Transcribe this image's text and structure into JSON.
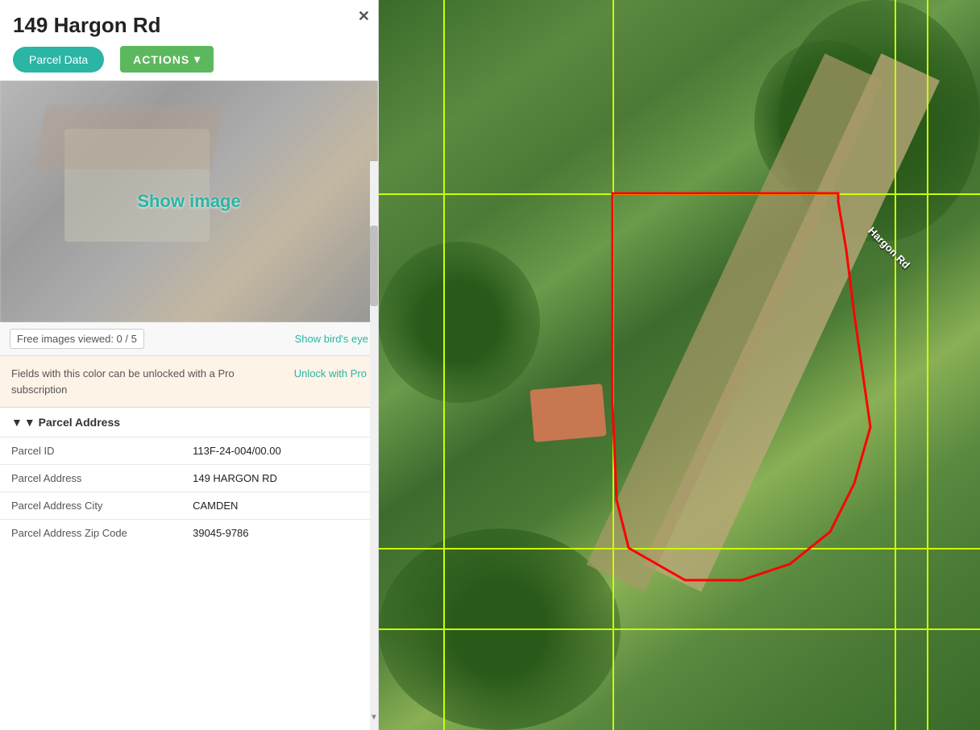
{
  "panel": {
    "title": "149 Hargon Rd",
    "close_button": "✕",
    "buttons": {
      "parcel_data": "Parcel Data",
      "actions": "ACTIONS"
    },
    "image": {
      "show_label": "Show image",
      "free_images": "Free images viewed: 0 / 5",
      "birds_eye": "Show bird's eye"
    },
    "pro_notice": {
      "text": "Fields with this color can be unlocked with a Pro subscription",
      "unlock_label": "Unlock with Pro"
    },
    "section_parcel_address": {
      "label": "▼ Parcel Address",
      "rows": [
        {
          "key": "Parcel ID",
          "value": "113F-24-004/00.00"
        },
        {
          "key": "Parcel Address",
          "value": "149 HARGON RD"
        },
        {
          "key": "Parcel Address City",
          "value": "CAMDEN"
        },
        {
          "key": "Parcel Address Zip Code",
          "value": "39045-9786"
        }
      ]
    }
  },
  "map": {
    "road_label": "Hargon Rd"
  },
  "icons": {
    "close": "✕",
    "actions_arrow": "▼",
    "section_arrow": "▼"
  }
}
